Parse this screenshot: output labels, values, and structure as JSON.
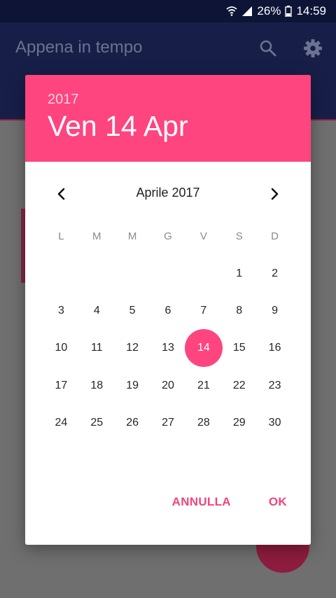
{
  "status_bar": {
    "battery": "26%",
    "time": "14:59"
  },
  "app_bar": {
    "title": "Appena in tempo"
  },
  "dialog": {
    "year": "2017",
    "selected_date": "Ven 14 Apr",
    "month_label": "Aprile 2017",
    "weekdays": [
      "L",
      "M",
      "M",
      "G",
      "V",
      "S",
      "D"
    ],
    "leading_blanks": 5,
    "days": [
      "1",
      "2",
      "3",
      "4",
      "5",
      "6",
      "7",
      "8",
      "9",
      "10",
      "11",
      "12",
      "13",
      "14",
      "15",
      "16",
      "17",
      "18",
      "19",
      "20",
      "21",
      "22",
      "23",
      "24",
      "25",
      "26",
      "27",
      "28",
      "29",
      "30"
    ],
    "selected_day": "14",
    "cancel_label": "ANNULLA",
    "ok_label": "OK"
  },
  "colors": {
    "accent": "#fe4580",
    "app_bar": "#171f48"
  },
  "icons": {
    "search": "search-icon",
    "settings": "gear-icon",
    "prev": "chevron-left-icon",
    "next": "chevron-right-icon"
  }
}
